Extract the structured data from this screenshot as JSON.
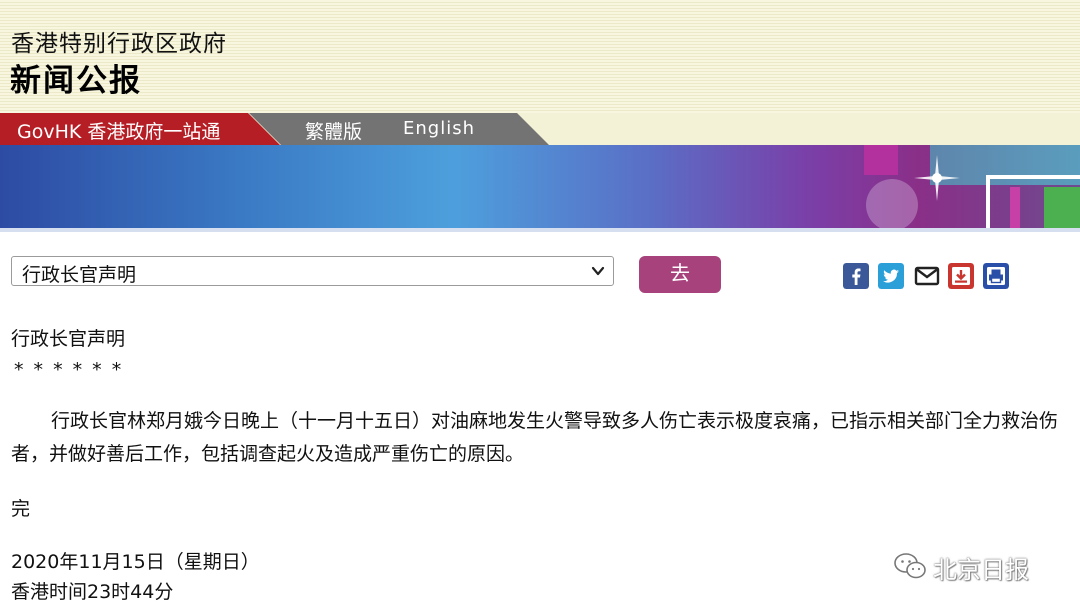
{
  "header": {
    "gov_name": "香港特别行政区政府",
    "press_title": "新闻公报"
  },
  "nav": {
    "govhk_label": "GovHK 香港政府一站通",
    "traditional_label": "繁體版",
    "english_label": "English"
  },
  "toolbar": {
    "select_value": "行政长官声明",
    "go_label": "去",
    "share_icons": [
      "facebook-icon",
      "twitter-icon",
      "email-icon",
      "download-icon",
      "print-icon"
    ]
  },
  "article": {
    "heading": "行政长官声明",
    "stars": "* * * * * *",
    "body": "行政长官林郑月娥今日晚上（十一月十五日）对油麻地发生火警导致多人伤亡表示极度哀痛，已指示相关部门全力救治伤者，并做好善后工作，包括调查起火及造成严重伤亡的原因。",
    "end_mark": "完",
    "date": "2020年11月15日（星期日）",
    "time": "香港时间23时44分"
  },
  "watermark": {
    "text": "北京日报"
  },
  "colors": {
    "govhk_red": "#b61e25",
    "nav_gray": "#737373",
    "go_button": "#a8427d",
    "header_bg": "#f8f6df"
  }
}
